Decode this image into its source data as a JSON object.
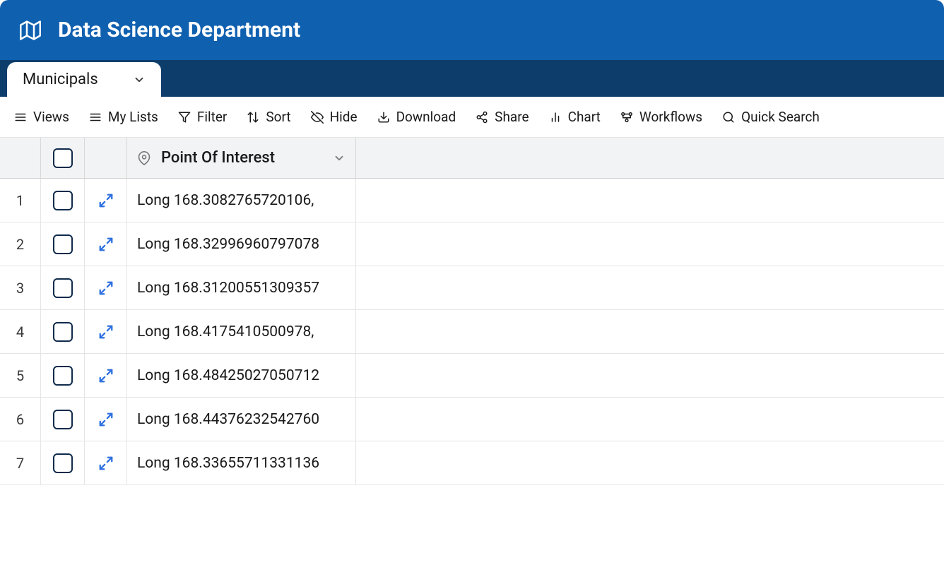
{
  "header": {
    "title": "Data Science Department"
  },
  "tab": {
    "label": "Municipals"
  },
  "toolbar": {
    "views": "Views",
    "my_lists": "My Lists",
    "filter": "Filter",
    "sort": "Sort",
    "hide": "Hide",
    "download": "Download",
    "share": "Share",
    "chart": "Chart",
    "workflows": "Workflows",
    "quick_search": "Quick Search"
  },
  "columns": {
    "point_of_interest": "Point Of Interest"
  },
  "rows": [
    {
      "num": "1",
      "value": "Long 168.3082765720106,"
    },
    {
      "num": "2",
      "value": "Long 168.32996960797078"
    },
    {
      "num": "3",
      "value": "Long 168.31200551309357"
    },
    {
      "num": "4",
      "value": "Long 168.4175410500978,"
    },
    {
      "num": "5",
      "value": "Long 168.48425027050712"
    },
    {
      "num": "6",
      "value": "Long 168.44376232542760"
    },
    {
      "num": "7",
      "value": "Long 168.33655711331136"
    }
  ]
}
